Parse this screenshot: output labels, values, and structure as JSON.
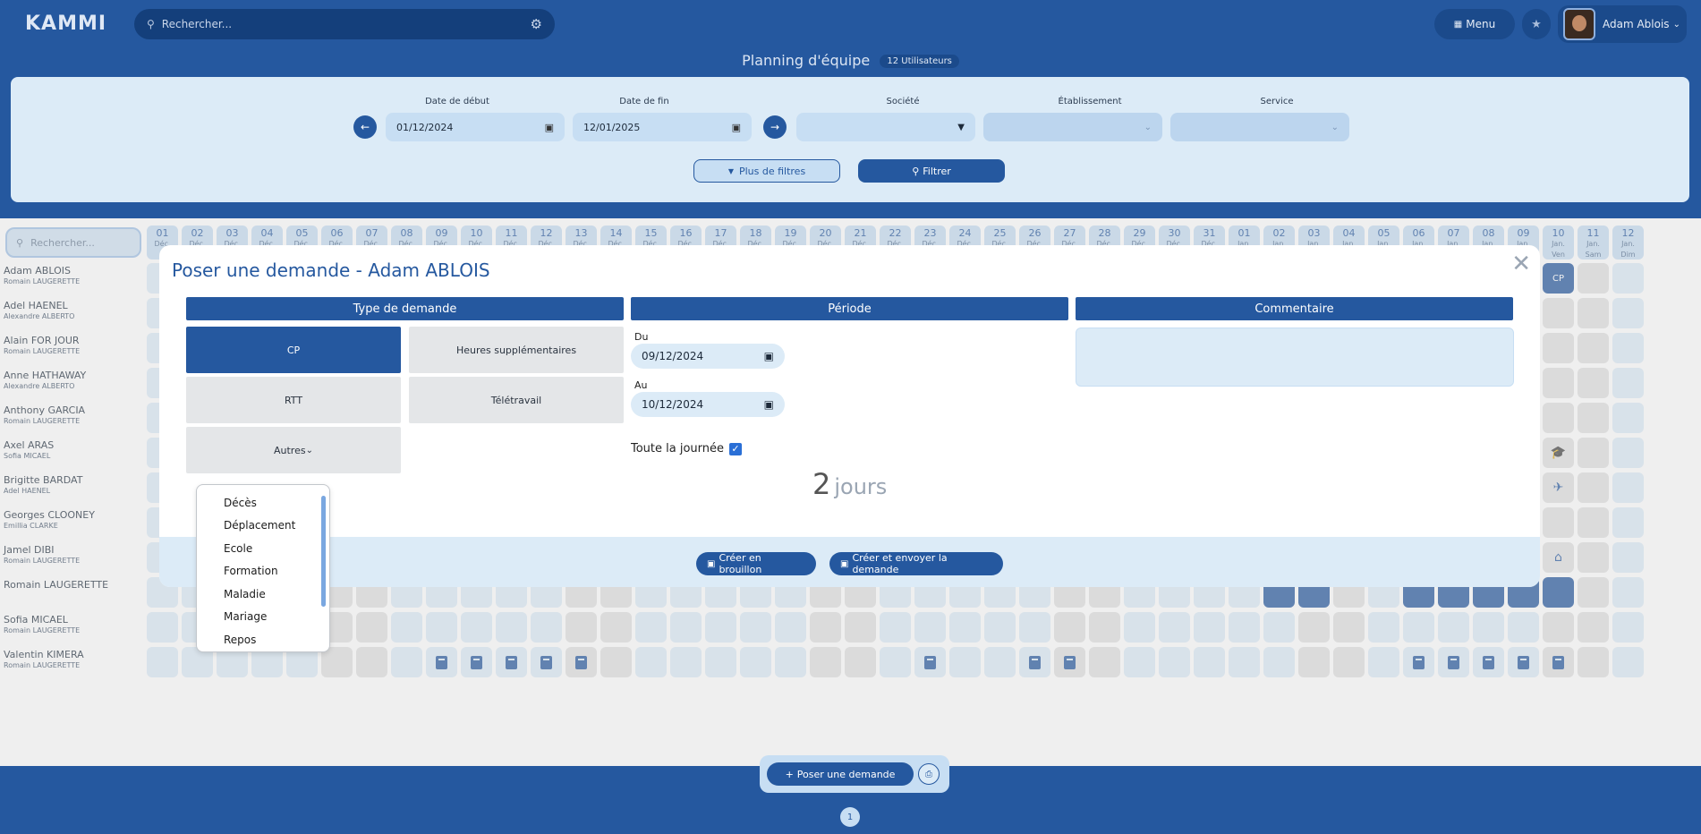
{
  "app": {
    "logo": "KAMMI"
  },
  "top": {
    "search_placeholder": "Rechercher...",
    "menu_label": "Menu",
    "user_name": "Adam Ablois"
  },
  "page": {
    "title": "Planning d'équipe",
    "badge": "12 Utilisateurs"
  },
  "filters": {
    "start_label": "Date de début",
    "start_value": "01/12/2024",
    "end_label": "Date de fin",
    "end_value": "12/01/2025",
    "company_label": "Société",
    "establishment_label": "Établissement",
    "service_label": "Service",
    "more_label": "Plus de filtres",
    "filter_label": "Filtrer"
  },
  "planning": {
    "search_placeholder": "Rechercher...",
    "days": [
      {
        "d": "01",
        "m": "Déc."
      },
      {
        "d": "02",
        "m": "Déc."
      },
      {
        "d": "03",
        "m": "Déc."
      },
      {
        "d": "04",
        "m": "Déc."
      },
      {
        "d": "05",
        "m": "Déc."
      },
      {
        "d": "06",
        "m": "Déc."
      },
      {
        "d": "07",
        "m": "Déc."
      },
      {
        "d": "08",
        "m": "Déc."
      },
      {
        "d": "09",
        "m": "Déc."
      },
      {
        "d": "10",
        "m": "Déc."
      },
      {
        "d": "11",
        "m": "Déc."
      },
      {
        "d": "12",
        "m": "Déc."
      },
      {
        "d": "13",
        "m": "Déc."
      },
      {
        "d": "14",
        "m": "Déc."
      },
      {
        "d": "15",
        "m": "Déc."
      },
      {
        "d": "16",
        "m": "Déc."
      },
      {
        "d": "17",
        "m": "Déc."
      },
      {
        "d": "18",
        "m": "Déc."
      },
      {
        "d": "19",
        "m": "Déc."
      },
      {
        "d": "20",
        "m": "Déc."
      },
      {
        "d": "21",
        "m": "Déc."
      },
      {
        "d": "22",
        "m": "Déc."
      },
      {
        "d": "23",
        "m": "Déc."
      },
      {
        "d": "24",
        "m": "Déc."
      },
      {
        "d": "25",
        "m": "Déc."
      },
      {
        "d": "26",
        "m": "Déc."
      },
      {
        "d": "27",
        "m": "Déc."
      },
      {
        "d": "28",
        "m": "Déc."
      },
      {
        "d": "29",
        "m": "Déc."
      },
      {
        "d": "30",
        "m": "Déc."
      },
      {
        "d": "31",
        "m": "Déc."
      },
      {
        "d": "01",
        "m": "Jan."
      },
      {
        "d": "02",
        "m": "Jan."
      },
      {
        "d": "03",
        "m": "Jan."
      },
      {
        "d": "04",
        "m": "Jan."
      },
      {
        "d": "05",
        "m": "Jan."
      },
      {
        "d": "06",
        "m": "Jan."
      },
      {
        "d": "07",
        "m": "Jan."
      },
      {
        "d": "08",
        "m": "Jan."
      },
      {
        "d": "09",
        "m": "Jan."
      },
      {
        "d": "10",
        "m": "Jan.",
        "w": "Ven"
      },
      {
        "d": "11",
        "m": "Jan.",
        "w": "Sam"
      },
      {
        "d": "12",
        "m": "Jan.",
        "w": "Dim"
      }
    ],
    "employees": [
      {
        "name": "Adam ABLOIS",
        "manager": "Romain LAUGERETTE"
      },
      {
        "name": "Adel HAENEL",
        "manager": "Alexandre ALBERTO"
      },
      {
        "name": "Alain FOR JOUR",
        "manager": "Romain LAUGERETTE"
      },
      {
        "name": "Anne HATHAWAY",
        "manager": "Alexandre ALBERTO"
      },
      {
        "name": "Anthony GARCIA",
        "manager": "Romain LAUGERETTE"
      },
      {
        "name": "Axel ARAS",
        "manager": "Sofia MICAEL"
      },
      {
        "name": "Brigitte BARDAT",
        "manager": "Adel HAENEL"
      },
      {
        "name": "Georges CLOONEY",
        "manager": "Emillia CLARKE"
      },
      {
        "name": "Jamel DIBI",
        "manager": "Romain LAUGERETTE"
      },
      {
        "name": "Romain LAUGERETTE",
        "manager": ""
      },
      {
        "name": "Sofia MICAEL",
        "manager": "Romain LAUGERETTE"
      },
      {
        "name": "Valentin KIMERA",
        "manager": "Romain LAUGERETTE"
      }
    ],
    "cp_cell_label": "CP"
  },
  "modal": {
    "title": "Poser une demande - Adam ABLOIS",
    "type_header": "Type de demande",
    "period_header": "Période",
    "comment_header": "Commentaire",
    "types": {
      "cp": "CP",
      "overtime": "Heures supplémentaires",
      "rtt": "RTT",
      "remote": "Télétravail",
      "others": "Autres"
    },
    "from_label": "Du",
    "from_value": "09/12/2024",
    "to_label": "Au",
    "to_value": "10/12/2024",
    "allday_label": "Toute la journée",
    "days_count": "2",
    "days_unit": "jours",
    "draft_btn": "Créer en brouillon",
    "send_btn": "Créer et envoyer la demande"
  },
  "dropdown": {
    "items": [
      "Décès",
      "Déplacement",
      "Ecole",
      "Formation",
      "Maladie",
      "Mariage",
      "Repos"
    ]
  },
  "bottom": {
    "new_request": "Poser une demande",
    "page": "1"
  },
  "colors": {
    "primary": "#25589f",
    "light": "#dcebf7",
    "grey": "#e1e1e1"
  }
}
